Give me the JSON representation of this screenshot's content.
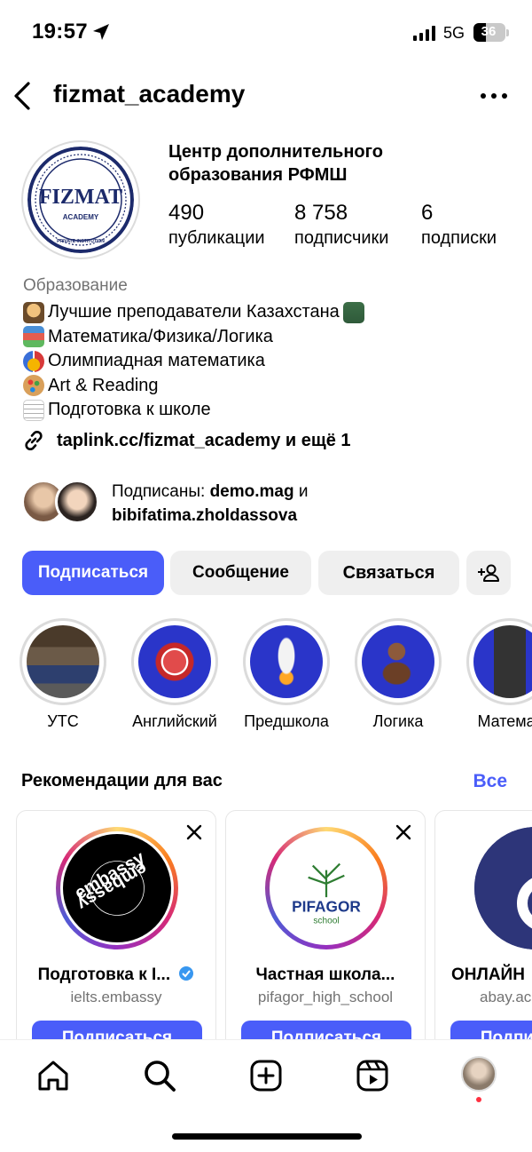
{
  "status_bar": {
    "time": "19:57",
    "network": "5G",
    "battery": "36"
  },
  "header": {
    "username": "fizmat_academy"
  },
  "profile": {
    "title": "Центр дополнительного образования РФМШ",
    "title_line1": "Центр дополнительного",
    "title_line2": "образования РФМШ",
    "avatar_logo": {
      "main": "FIZMAT",
      "sub": "ACADEMY",
      "ring": "PRIVATE INSTITUTION"
    },
    "stats": [
      {
        "value": "490",
        "label": "публикации"
      },
      {
        "value": "8 758",
        "label": "подписчики"
      },
      {
        "value": "6",
        "label": "подписки"
      }
    ],
    "category": "Образование",
    "bio": [
      {
        "icon": "teacher-emoji",
        "text": "Лучшие преподаватели Казахстана",
        "trail_icon": "teacher-emoji"
      },
      {
        "icon": "books-emoji",
        "text": "Математика/Физика/Логика"
      },
      {
        "icon": "medal-emoji",
        "text": "Олимпиадная математика"
      },
      {
        "icon": "palette-emoji",
        "text": "Art & Reading"
      },
      {
        "icon": "memo-emoji",
        "text": "Подготовка к школе"
      }
    ],
    "link": "taplink.cc/fizmat_academy и ещё 1",
    "followed_by": {
      "prefix": "Подписаны: ",
      "user1": "demo.mag",
      "conj": " и",
      "user2": "bibifatima.zholdassova"
    }
  },
  "buttons": {
    "follow": "Подписаться",
    "message": "Сообщение",
    "contact": "Связаться"
  },
  "highlights": [
    {
      "label": "УТС",
      "icon": "group-photo"
    },
    {
      "label": "Английский",
      "icon": "puzzle-icon"
    },
    {
      "label": "Предшкола",
      "icon": "rocket-icon"
    },
    {
      "label": "Логика",
      "icon": "chess-pawn-icon"
    },
    {
      "label": "Математ",
      "icon": "calculator-icon"
    }
  ],
  "suggestions": {
    "title": "Рекомендации для вас",
    "see_all": "Все",
    "cards": [
      {
        "name": "Подготовка к I...",
        "handle": "ielts.embassy",
        "button": "Подписаться",
        "logo": "embassy",
        "verified": true
      },
      {
        "name": "Частная школа...",
        "handle": "pifagor_high_school",
        "button": "Подписаться",
        "logo_main": "PIFAGOR",
        "logo_sub": "school"
      },
      {
        "name": "ОНЛАЙН",
        "handle": "abay.ac",
        "button": "Подписаться"
      }
    ]
  },
  "colors": {
    "accent": "#4a5df9",
    "secondary_text": "#737373",
    "button_bg": "#efefef",
    "notification": "#ff3040"
  }
}
